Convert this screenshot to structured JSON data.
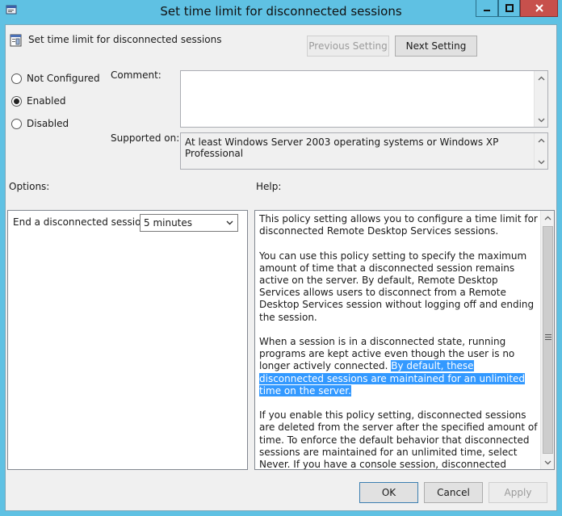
{
  "window": {
    "title": "Set time limit for disconnected sessions"
  },
  "header": {
    "policy_title": "Set time limit for disconnected sessions",
    "previous_label": "Previous Setting",
    "next_label": "Next Setting"
  },
  "state": {
    "options": [
      {
        "label": "Not Configured",
        "selected": false
      },
      {
        "label": "Enabled",
        "selected": true
      },
      {
        "label": "Disabled",
        "selected": false
      }
    ]
  },
  "comment": {
    "label": "Comment:",
    "value": ""
  },
  "supported": {
    "label": "Supported on:",
    "value": "At least Windows Server 2003 operating systems or Windows XP Professional"
  },
  "options_section": {
    "label": "Options:",
    "setting_label": "End a disconnected session",
    "setting_value": "5 minutes"
  },
  "help": {
    "label": "Help:",
    "p1": "This policy setting allows you to configure a time limit for disconnected Remote Desktop Services sessions.",
    "p2": "You can use this policy setting to specify the maximum amount of time that a disconnected session remains active on the server. By default, Remote Desktop Services allows users to disconnect from a Remote Desktop Services session without logging off and ending the session.",
    "p3_plain": "When a session is in a disconnected state, running programs are kept active even though the user is no longer actively connected.",
    "p3_highlight": "By default, these disconnected sessions are maintained for an unlimited time on the server.",
    "p4": "If you enable this policy setting, disconnected sessions are deleted from the server after the specified amount of time. To enforce the default behavior that disconnected sessions are maintained for an unlimited time, select Never. If you have a console session, disconnected session time limits do not apply."
  },
  "footer": {
    "ok_label": "OK",
    "cancel_label": "Cancel",
    "apply_label": "Apply"
  },
  "colors": {
    "titlebar": "#5fc1e3",
    "close": "#c7504c",
    "selection": "#3399ff",
    "dialog": "#f0f0f0"
  }
}
